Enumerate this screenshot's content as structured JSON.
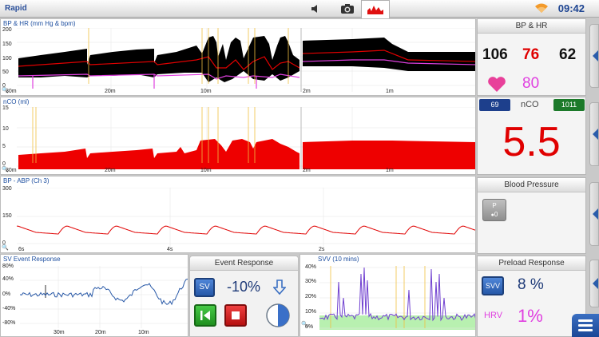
{
  "topbar": {
    "app_name": "Rapid",
    "clock": "09:42"
  },
  "icons": {
    "speaker": "speaker-icon",
    "camera": "camera-icon",
    "trend": "trend-chart-icon",
    "wifi": "wifi-icon",
    "menu": "menu-icon"
  },
  "colors": {
    "bp_trace": "#000000",
    "mean_line": "#e00000",
    "hr_line": "#e040e0",
    "nco_fill": "#ee0000",
    "event_marker": "#f0c040",
    "title_blue": "#1e4fa0",
    "svv_fill": "#b8f0b0",
    "svv_line": "#7040d0",
    "sv_line": "#2a5aa8"
  },
  "charts": {
    "bp_hr": {
      "title": "BP & HR (mm Hg & bpm)",
      "yticks": [
        "200",
        "150",
        "100",
        "50",
        "0"
      ],
      "xticks_left": [
        "30m",
        "20m",
        "10m"
      ],
      "xticks_right": [
        "2m",
        "1m"
      ]
    },
    "nco": {
      "title": "nCO (ml)",
      "yticks": [
        "15",
        "10",
        "5",
        "0"
      ],
      "xticks_left": [
        "30m",
        "20m",
        "10m"
      ],
      "xticks_right": [
        "2m",
        "1m"
      ]
    },
    "abp": {
      "title": "BP - ABP (Ch 3)",
      "yticks": [
        "300",
        "150",
        "0"
      ],
      "xticks": [
        "6s",
        "4s",
        "2s"
      ]
    },
    "sv_event": {
      "title": "SV Event Response",
      "yticks": [
        "80%",
        "40%",
        "0%",
        "-40%",
        "-80%"
      ],
      "xticks": [
        "30m",
        "20m",
        "10m"
      ]
    },
    "svv": {
      "title": "SVV (10 mins)",
      "yticks": [
        "40%",
        "30%",
        "20%",
        "10%",
        "0%"
      ]
    }
  },
  "event_response": {
    "title": "Event Response",
    "sv_label": "SV",
    "value": "-10%",
    "direction": "arrow-down-icon"
  },
  "bp_hr_panel": {
    "title": "BP & HR",
    "systolic": "106",
    "mean": "76",
    "diastolic": "62",
    "hr": "80",
    "heart_icon": "heart-icon"
  },
  "nco_panel": {
    "left_badge": "69",
    "label": "nCO",
    "right_badge": "1011",
    "value": "5.5"
  },
  "bp_panel": {
    "title": "Blood Pressure",
    "button_top": "P",
    "button_bottom": "0"
  },
  "preload_panel": {
    "title": "Preload Response",
    "svv_label": "SVV",
    "svv_value": "8 %",
    "hrv_label": "HRV",
    "hrv_value": "1%"
  }
}
